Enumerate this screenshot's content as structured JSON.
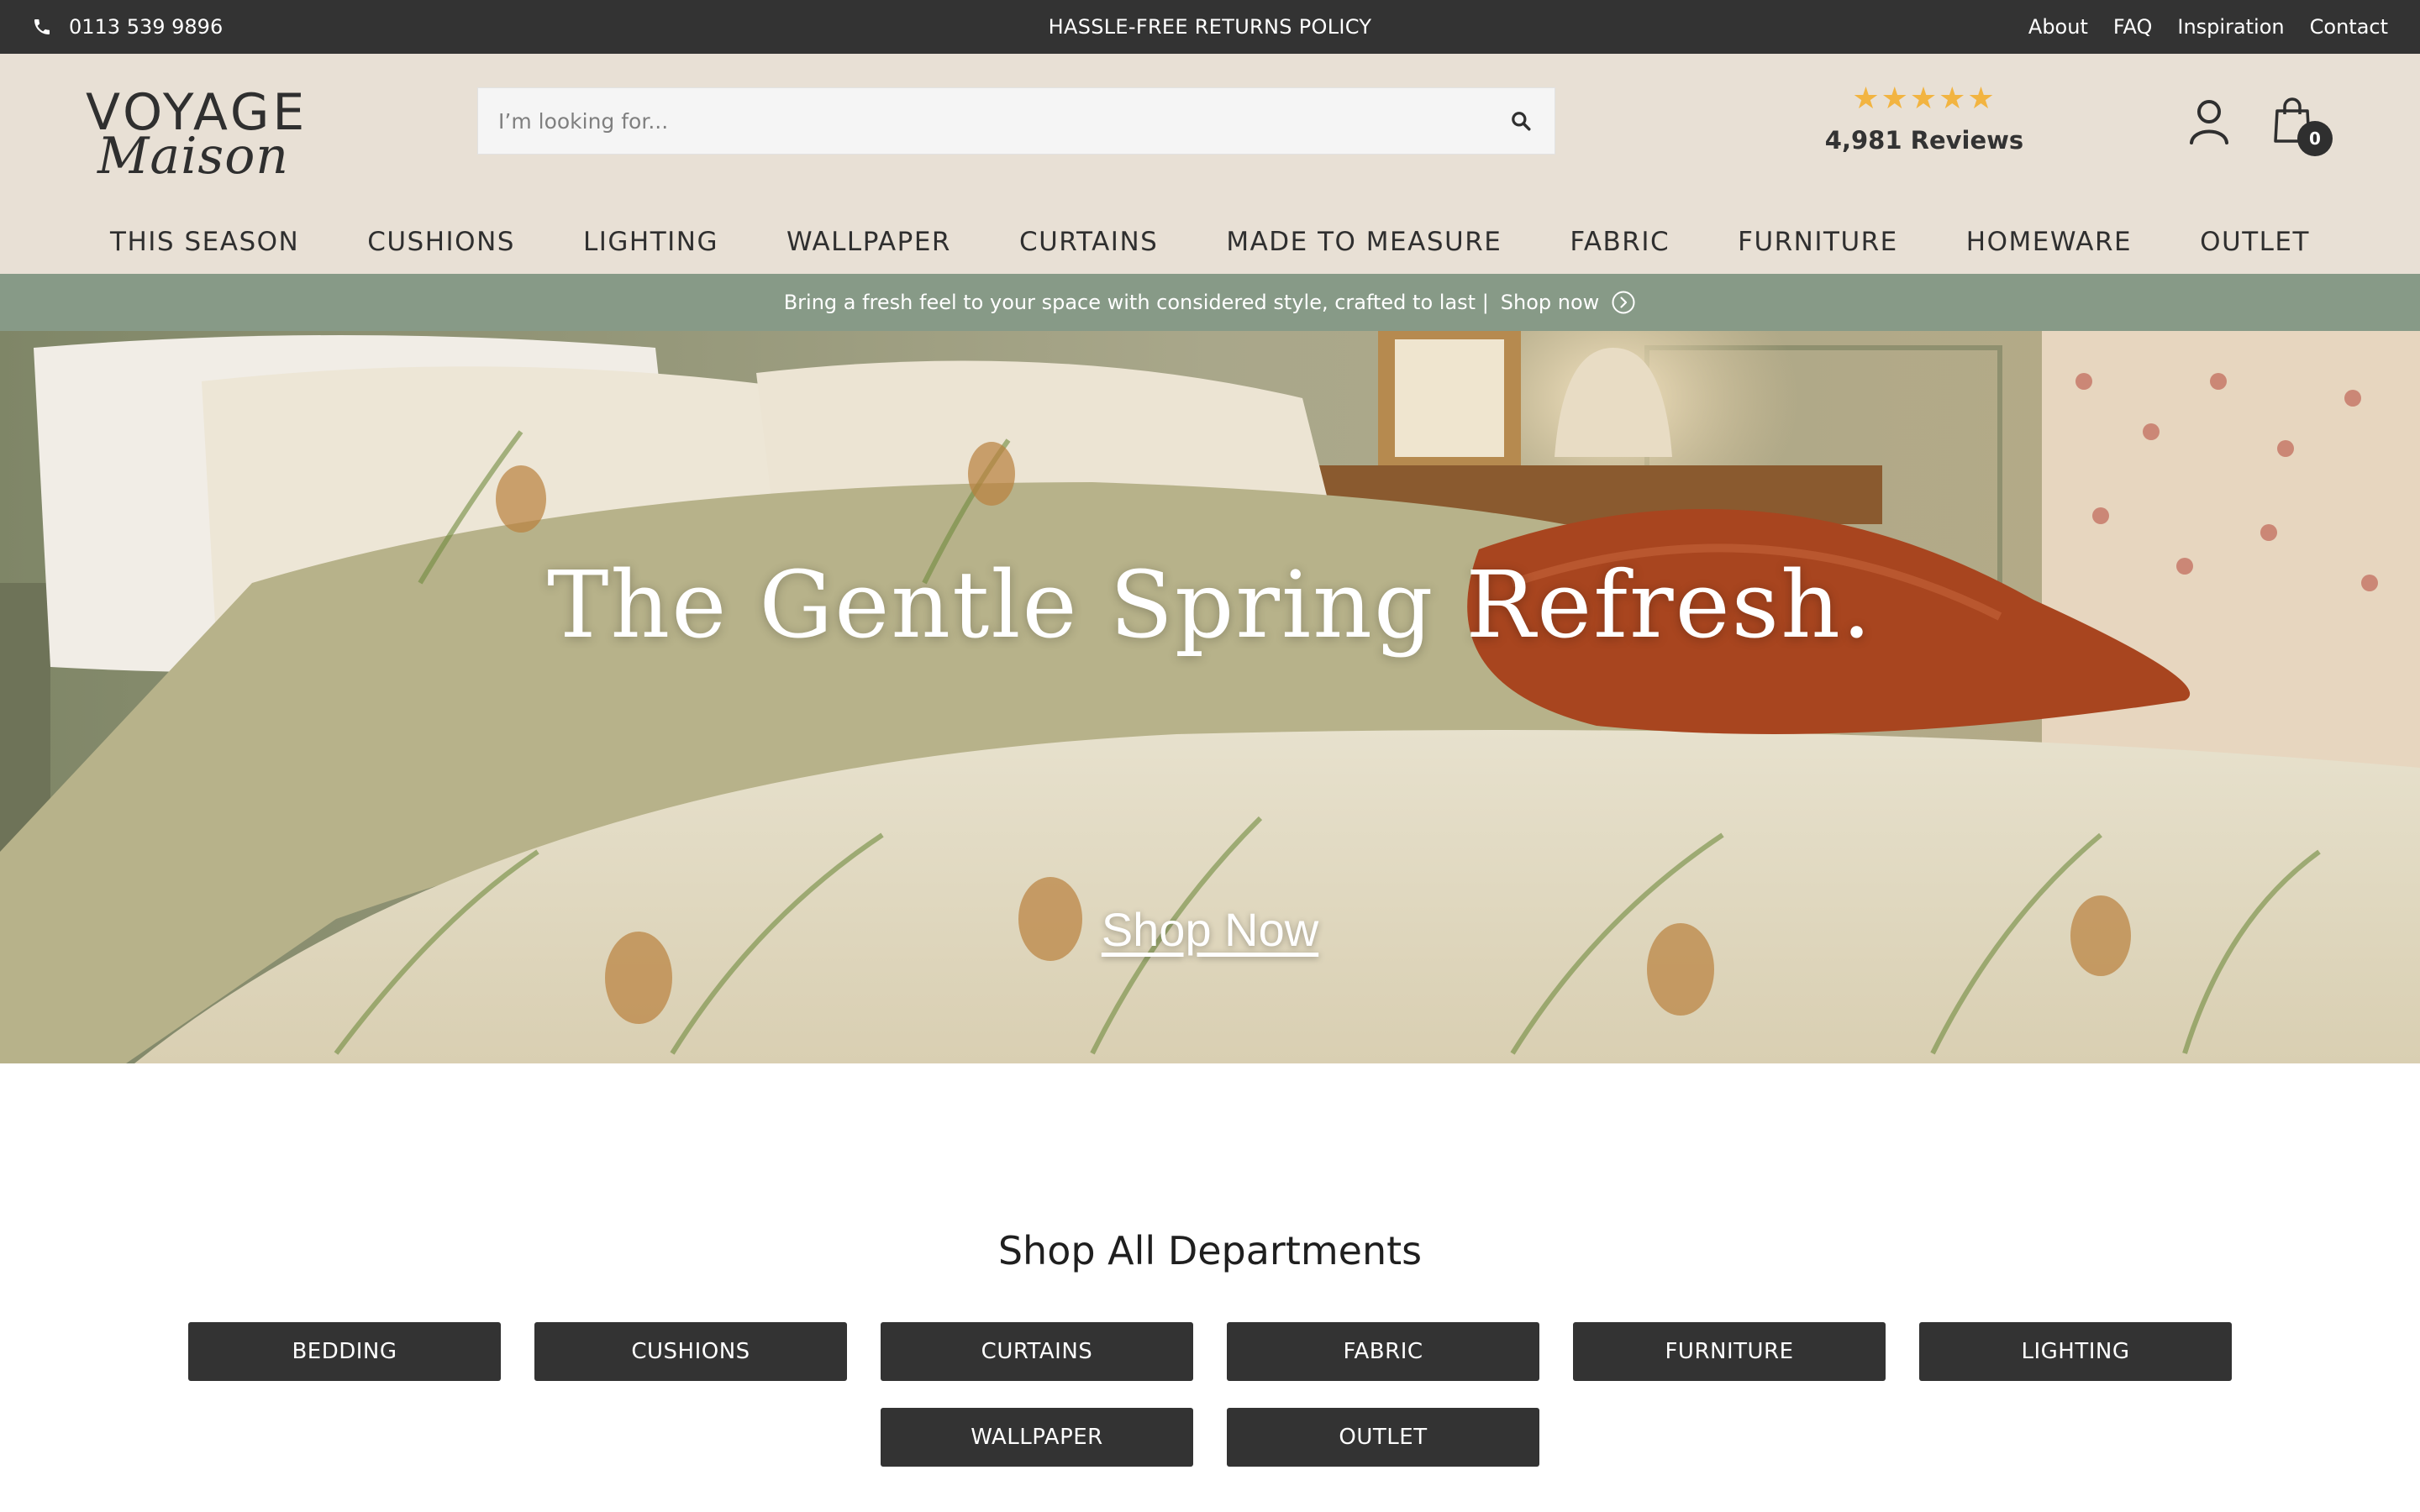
{
  "topbar": {
    "phone_icon": "phone-icon",
    "phone": "0113 539 9896",
    "promo": "HASSLE-FREE RETURNS POLICY",
    "links": [
      {
        "label": "About"
      },
      {
        "label": "FAQ"
      },
      {
        "label": "Inspiration"
      },
      {
        "label": "Contact"
      }
    ]
  },
  "header": {
    "logo_line1": "VOYAGE",
    "logo_line2": "Maison",
    "search_placeholder": "I’m looking for...",
    "search_value": "",
    "search_icon": "search-icon",
    "rating_stars": 5,
    "stars_display": "★★★★★",
    "reviews": "4,981 Reviews",
    "account_icon": "user-icon",
    "cart_icon": "shopping-bag-icon",
    "cart_count": "0"
  },
  "nav": {
    "items": [
      {
        "label": "THIS SEASON"
      },
      {
        "label": "CUSHIONS"
      },
      {
        "label": "LIGHTING"
      },
      {
        "label": "WALLPAPER"
      },
      {
        "label": "CURTAINS"
      },
      {
        "label": "MADE TO MEASURE"
      },
      {
        "label": "FABRIC"
      },
      {
        "label": "FURNITURE"
      },
      {
        "label": "HOMEWARE"
      },
      {
        "label": "OUTLET"
      }
    ]
  },
  "strip": {
    "text": "Bring a fresh feel to your space with considered style, crafted to last |",
    "link": "Shop now",
    "link_icon": "chevron-right-circle-icon"
  },
  "hero": {
    "title": "The Gentle Spring Refresh.",
    "cta": "Shop Now"
  },
  "departments": {
    "title": "Shop All Departments",
    "row1": [
      {
        "label": "BEDDING"
      },
      {
        "label": "CUSHIONS"
      },
      {
        "label": "CURTAINS"
      },
      {
        "label": "FABRIC"
      },
      {
        "label": "FURNITURE"
      },
      {
        "label": "LIGHTING"
      }
    ],
    "row2": [
      {
        "label": "WALLPAPER"
      },
      {
        "label": "OUTLET"
      }
    ]
  },
  "colors": {
    "topbar_bg": "#333333",
    "header_bg": "#e8e0d5",
    "strip_bg": "#879a87",
    "button_bg": "#333333",
    "star": "#f2b441"
  }
}
